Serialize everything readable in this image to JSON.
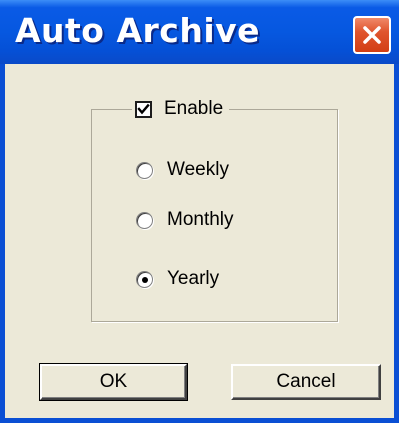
{
  "window": {
    "title": "Auto Archive",
    "close_label": "Close"
  },
  "options": {
    "enable_label": "Enable",
    "enable_checked": true,
    "frequency": [
      {
        "label": "Weekly",
        "selected": false
      },
      {
        "label": "Monthly",
        "selected": false
      },
      {
        "label": "Yearly",
        "selected": true
      }
    ]
  },
  "buttons": {
    "ok_label": "OK",
    "cancel_label": "Cancel"
  },
  "colors": {
    "titlebar": "#0658e0",
    "close_button": "#d23e14",
    "dialog_background": "#ece9d8"
  }
}
